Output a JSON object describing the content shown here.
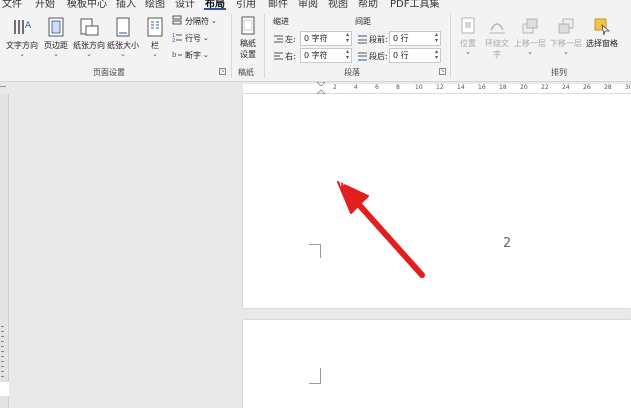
{
  "menu": {
    "tabs": [
      "文件",
      "开始",
      "模板中心",
      "插入",
      "绘图",
      "设计",
      "布局",
      "引用",
      "邮件",
      "审阅",
      "视图",
      "帮助",
      "PDF工具集"
    ],
    "active": "布局"
  },
  "ribbon": {
    "page_setup": {
      "text_direction": "文字方向",
      "margins": "页边距",
      "orientation": "纸张方向",
      "size": "纸张大小",
      "columns": "栏",
      "breaks": "分隔符",
      "line_numbers": "行号",
      "hyphenation": "断字",
      "group_label": "页面设置"
    },
    "manuscript": {
      "setup_line1": "稿纸",
      "setup_line2": "设置",
      "group_label": "稿纸"
    },
    "paragraph": {
      "indent_header": "缩进",
      "spacing_header": "间距",
      "left_label": "左:",
      "left_value": "0 字符",
      "right_label": "右:",
      "right_value": "0 字符",
      "before_label": "段前:",
      "before_value": "0 行",
      "after_label": "段后:",
      "after_value": "0 行",
      "group_label": "段落"
    },
    "arrange": {
      "position_line1": "位置",
      "wrap_line1": "环绕文",
      "wrap_line2": "字",
      "forward": "上移一层",
      "backward": "下移一层",
      "selection_pane": "选择窗格",
      "group_label": "排列"
    }
  },
  "ruler": {
    "labels": [
      "2",
      "4",
      "6",
      "8",
      "10",
      "12",
      "14",
      "16",
      "18",
      "20",
      "22",
      "24",
      "26",
      "28",
      "30"
    ]
  },
  "document": {
    "page_number": "2"
  },
  "colors": {
    "accent": "#2b579a",
    "arrow": "#e02020"
  }
}
